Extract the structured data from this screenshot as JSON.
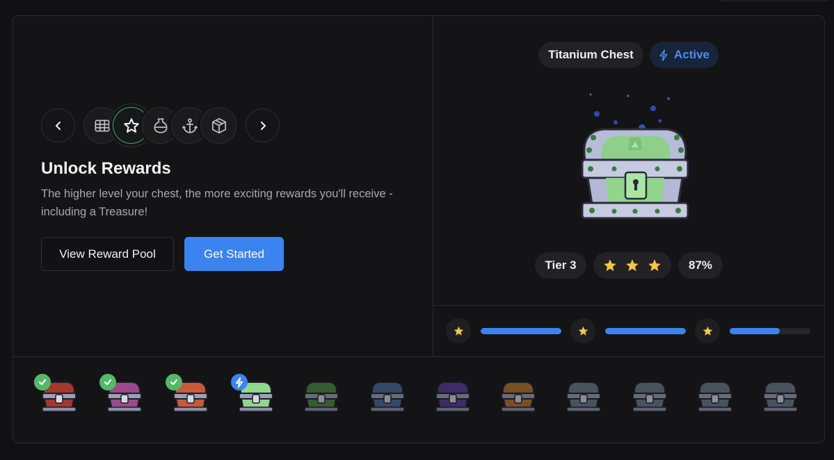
{
  "header": {
    "chest_name": "Titanium Chest",
    "status": "Active"
  },
  "nav": {
    "prev_icon": "chevron-left-icon",
    "next_icon": "chevron-right-icon",
    "icons": [
      "grid-icon",
      "star-icon",
      "potion-icon",
      "anchor-icon",
      "box-icon"
    ],
    "selected": "star-icon"
  },
  "main": {
    "title": "Unlock Rewards",
    "description": "The higher level your chest, the more exciting rewards you'll receive - including a Treasure!",
    "secondary_button": "View Reward Pool",
    "primary_button": "Get Started"
  },
  "stats": {
    "tier": "Tier 3",
    "stars": 3,
    "percent": "87%"
  },
  "progress": [
    {
      "icon": "star-icon",
      "fill": 1.0
    },
    {
      "icon": "star-icon",
      "fill": 1.0
    },
    {
      "icon": "star-icon",
      "fill": 0.62
    }
  ],
  "chests": [
    {
      "color": "#a3382c",
      "status": "complete"
    },
    {
      "color": "#9a4a8a",
      "status": "complete"
    },
    {
      "color": "#c85a3a",
      "status": "complete"
    },
    {
      "color": "#8fd88f",
      "status": "active"
    },
    {
      "color": "#4c8a44",
      "status": "locked"
    },
    {
      "color": "#4a6a9a",
      "status": "locked"
    },
    {
      "color": "#5a3a9a",
      "status": "locked"
    },
    {
      "color": "#b8742e",
      "status": "locked"
    },
    {
      "color": "#6a7a8a",
      "status": "locked"
    },
    {
      "color": "#6a7a8a",
      "status": "locked"
    },
    {
      "color": "#6a7a8a",
      "status": "locked"
    },
    {
      "color": "#6a7a8a",
      "status": "locked"
    }
  ],
  "colors": {
    "accent": "#3a84f2",
    "success": "#53b86b",
    "star": "#f5c542"
  }
}
